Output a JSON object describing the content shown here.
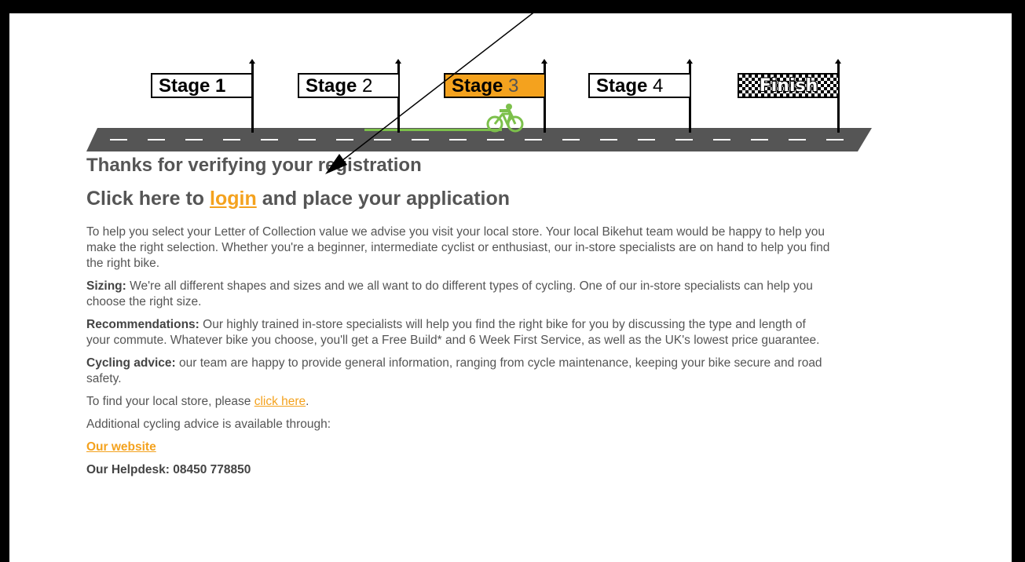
{
  "progress": {
    "stages": [
      {
        "word": "Stage",
        "num": "1",
        "active": false
      },
      {
        "word": "Stage",
        "num": "2",
        "active": false
      },
      {
        "word": "Stage",
        "num": "3",
        "active": true
      },
      {
        "word": "Stage",
        "num": "4",
        "active": false
      }
    ],
    "finish_label": "Finish",
    "active_color": "#f4a21e",
    "progress_color": "#7cc04b"
  },
  "main": {
    "heading": "Thanks for verifying your registration",
    "cta_prefix": "Click here to",
    "cta_link": "login",
    "cta_suffix": "and place your application",
    "intro": "To help you select your Letter of Collection value we advise you visit your local store. Your local Bikehut team would be happy to help you make the right selection. Whether you're a beginner, intermediate cyclist or enthusiast, our in-store specialists are on hand to help you find the right bike.",
    "sizing_label": "Sizing:",
    "sizing_text": "We're all different shapes and sizes and we all want to do different types of cycling. One of our in-store specialists can help you choose the right size.",
    "recommendations_label": "Recommendations:",
    "recommendations_text": "Our highly trained in-store specialists will help you find the right bike for you by discussing the type and length of your commute. Whatever bike you choose, you'll get a Free Build* and 6 Week First Service, as well as the UK's lowest price guarantee.",
    "cycling_label": "Cycling advice:",
    "cycling_text": "our team are happy to provide general information, ranging from cycle maintenance, keeping your bike secure and road safety.",
    "store_prefix": "To find your local store, please",
    "store_link": "click here",
    "store_suffix": ".",
    "additional": "Additional cycling advice is available through:",
    "website_link": "Our website",
    "helpdesk": "Our Helpdesk: 08450 778850"
  },
  "colors": {
    "link": "#f4a21e",
    "text": "#555555",
    "frame": "#000000"
  }
}
